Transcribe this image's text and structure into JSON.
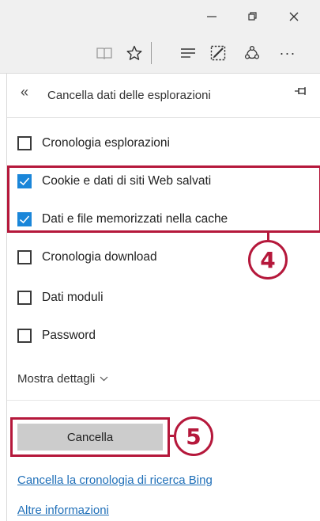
{
  "window": {
    "controls": [
      "minimize-icon",
      "restore-icon",
      "close-icon"
    ]
  },
  "toolbar": {
    "icons": [
      "reading-view-icon",
      "favorites-star-icon",
      "hub-icon",
      "web-note-icon",
      "share-icon",
      "more-icon"
    ],
    "more_label": "···"
  },
  "panel": {
    "back_label": "«",
    "title": "Cancella dati delle esplorazioni",
    "options": [
      {
        "label": "Cronologia esplorazioni",
        "checked": false
      },
      {
        "label": "Cookie e dati di siti Web salvati",
        "checked": true
      },
      {
        "label": "Dati e file memorizzati nella cache",
        "checked": true
      },
      {
        "label": "Cronologia download",
        "checked": false
      },
      {
        "label": "Dati moduli",
        "checked": false
      },
      {
        "label": "Password",
        "checked": false
      }
    ],
    "details_label": "Mostra dettagli",
    "clear_button": "Cancella",
    "links": [
      "Cancella la cronologia di ricerca Bing",
      "Altre informazioni"
    ]
  },
  "callouts": {
    "step4": "4",
    "step5": "5"
  },
  "colors": {
    "accent": "#1a86d9",
    "annotation": "#b5183b",
    "link": "#1f6fb8"
  }
}
